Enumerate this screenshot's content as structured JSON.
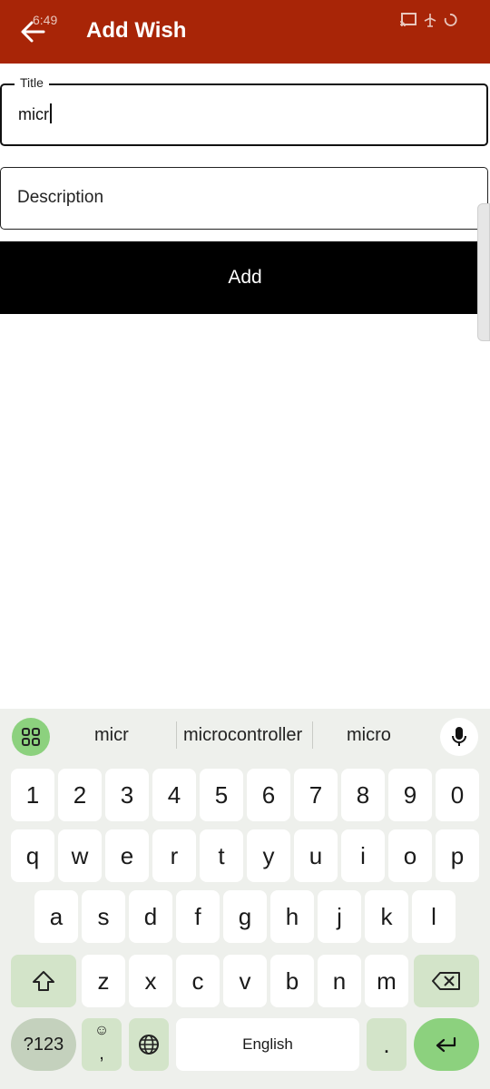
{
  "status": {
    "time": "6:49"
  },
  "appbar": {
    "title": "Add Wish",
    "back_icon": "arrow-left-icon"
  },
  "form": {
    "title_label": "Title",
    "title_value": "micr",
    "description_placeholder": "Description",
    "add_label": "Add"
  },
  "keyboard": {
    "suggestions": [
      "micr",
      "microcontroller",
      "micro"
    ],
    "row_numbers": [
      "1",
      "2",
      "3",
      "4",
      "5",
      "6",
      "7",
      "8",
      "9",
      "0"
    ],
    "row1": [
      "q",
      "w",
      "e",
      "r",
      "t",
      "y",
      "u",
      "i",
      "o",
      "p"
    ],
    "row2": [
      "a",
      "s",
      "d",
      "f",
      "g",
      "h",
      "j",
      "k",
      "l"
    ],
    "row3": [
      "z",
      "x",
      "c",
      "v",
      "b",
      "n",
      "m"
    ],
    "symbols_label": "?123",
    "comma": ",",
    "space_label": "English",
    "period": "."
  },
  "colors": {
    "appbar": "#a82507",
    "accent_green": "#8cd17e",
    "button": "#000000"
  }
}
